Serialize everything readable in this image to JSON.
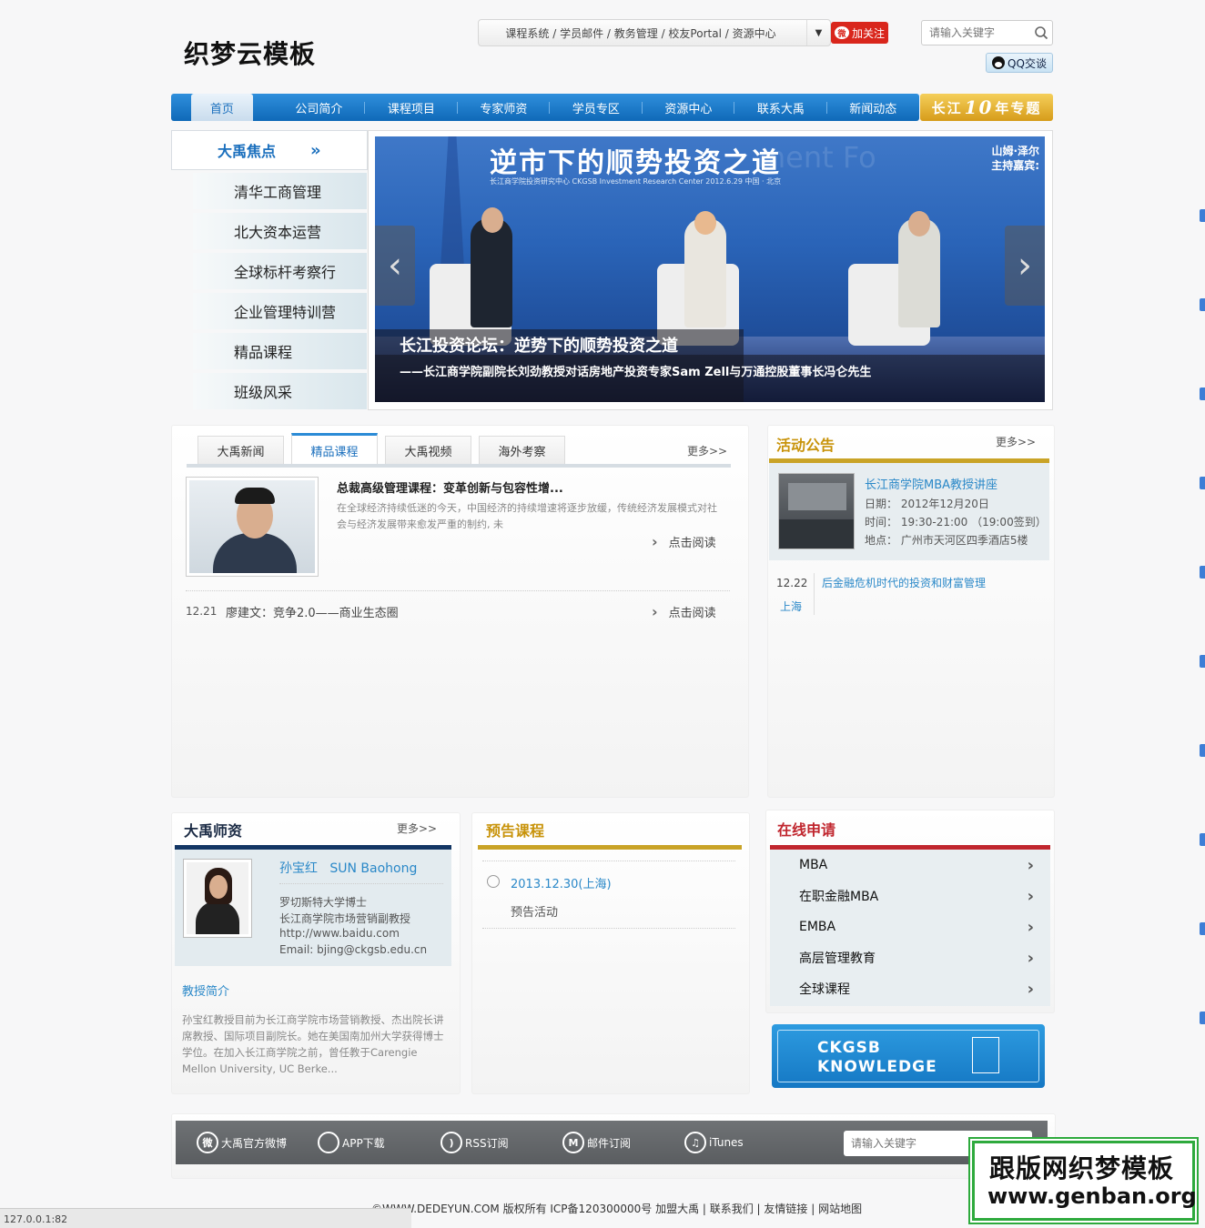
{
  "header": {
    "logo": "织梦云模板",
    "top_links": "课程系统 / 学员邮件 / 教务管理 / 校友Portal / 资源中心",
    "follow": "加关注",
    "search_placeholder": "请输入关键字",
    "qq": "QQ交谈"
  },
  "nav": {
    "items": [
      "首页",
      "公司简介",
      "课程项目",
      "专家师资",
      "学员专区",
      "资源中心",
      "联系大禹",
      "新闻动态"
    ],
    "special": {
      "pre": "长江",
      "num": "10",
      "post": "年专题"
    }
  },
  "focus": {
    "title": "大禹焦点",
    "items": [
      "清华工商管理",
      "北大资本运营",
      "全球标杆考察行",
      "企业管理特训营",
      "精品课程",
      "班级风采"
    ]
  },
  "banner": {
    "title": "逆市下的顺势投资之道",
    "subtitle": "长江商学院投资研究中心  CKGSB Investment Research Center        2012.6.29  中国 · 北京",
    "ghost": "ment Fo",
    "corner": "山姆·泽尔\n主持嘉宾:",
    "caption_title": "长江投资论坛：逆势下的顺势投资之道",
    "caption_sub": "——长江商学院副院长刘劲教授对话房地产投资专家Sam Zell与万通控股董事长冯仑先生",
    "prev": "‹",
    "next": "›"
  },
  "news": {
    "tabs": [
      "大禹新闻",
      "精品课程",
      "大禹视频",
      "海外考察"
    ],
    "more": "更多>>",
    "feature_title": "总裁高级管理课程：变革创新与包容性增...",
    "feature_desc": "在全球经济持续低迷的今天，中国经济的持续增速将逐步放缓，传统经济发展模式对社会与经济发展带来愈发严重的制约, 未",
    "read_more": "点击阅读",
    "item_date": "12.21",
    "item_title": "廖建文：竞争2.0——商业生态圈"
  },
  "activity": {
    "title": "活动公告",
    "more": "更多>>",
    "event_title": "长江商学院MBA教授讲座",
    "event_date": "日期： 2012年12月20日",
    "event_time": "时间： 19:30-21:00 （19:00签到）",
    "event_place": "地点： 广州市天河区四季酒店5楼",
    "item_date": "12.22",
    "item_city": "上海",
    "item_title": "后金融危机时代的投资和财富管理"
  },
  "faculty": {
    "title": "大禹师资",
    "more": "更多>>",
    "name": "孙宝红   SUN Baohong",
    "line1": "罗切斯特大学博士",
    "line2": "长江商学院市场营销副教授",
    "line3": "http://www.baidu.com",
    "line4": "Email: bjing@ckgsb.edu.cn",
    "intro_title": "教授简介",
    "intro": "孙宝红教授目前为长江商学院市场营销教授、杰出院长讲席教授、国际项目副院长。她在美国南加州大学获得博士学位。在加入长江商学院之前，曾任教于Carengie Mellon University, UC Berke..."
  },
  "forecast": {
    "title": "预告课程",
    "date": "2013.12.30(上海)",
    "sub": "预告活动"
  },
  "apply": {
    "title": "在线申请",
    "items": [
      "MBA",
      "在职金融MBA",
      "EMBA",
      "高层管理教育",
      "全球课程"
    ],
    "ck_line1": "CKGSB",
    "ck_line2": "KNOWLEDGE"
  },
  "footer": {
    "links": [
      "大禹官方微博",
      "APP下载",
      "RSS订阅",
      "邮件订阅",
      "iTunes"
    ],
    "search_placeholder": "请输入关键字",
    "copyright": "©WWW.DEDEYUN.COM 版权所有 ICP备120300000号 加盟大禹 | 联系我们 | 友情链接 | 网站地图"
  },
  "status_bar": "127.0.0.1:82",
  "watermark": {
    "line1": "跟版网织梦模板",
    "line2": "www.genban.org"
  }
}
